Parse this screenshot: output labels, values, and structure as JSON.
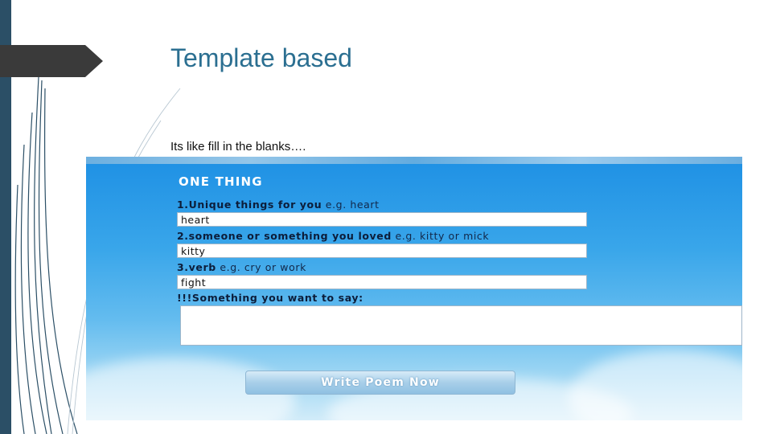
{
  "slide": {
    "title": "Template based",
    "body": "Its like fill in the blanks…."
  },
  "form": {
    "heading": "ONE THING",
    "questions": [
      {
        "label": "1.Unique things for you",
        "example": " e.g. heart",
        "value": "heart"
      },
      {
        "label": "2.someone or something you loved",
        "example": " e.g. kitty or mick",
        "value": "kitty"
      },
      {
        "label": "3.verb",
        "example": " e.g. cry or work",
        "value": "fight"
      }
    ],
    "say_label": "!!!Something you want to say:",
    "say_value": "",
    "button_label": "Write Poem Now"
  },
  "colors": {
    "left_bar": "#2b4f66",
    "title": "#2b6f91",
    "title_tab": "#3a3a3a",
    "form_sky_top": "#1e90e4"
  }
}
